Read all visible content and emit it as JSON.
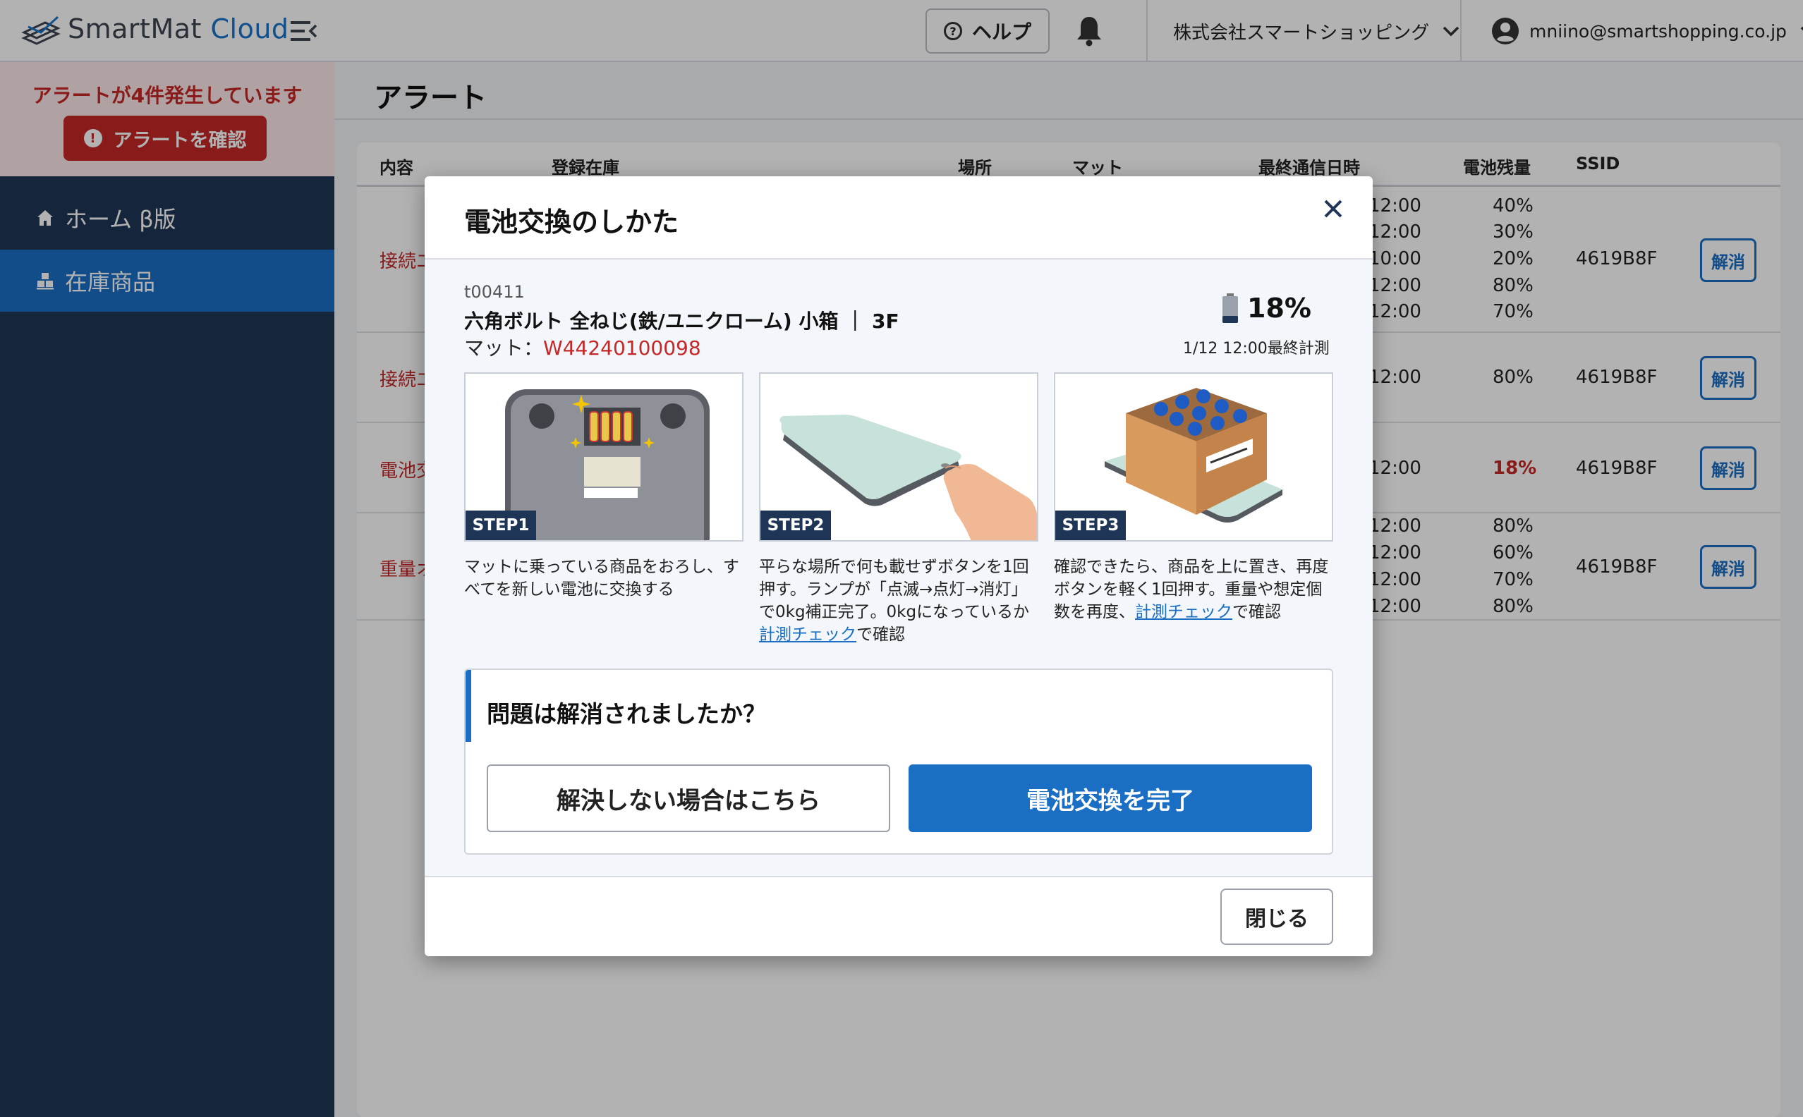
{
  "header": {
    "logo_smart": "SmartMat ",
    "logo_cloud": "Cloud",
    "help_label": "ヘルプ",
    "company": "株式会社スマートショッピング",
    "user_email": "mniino@smartshopping.co.jp"
  },
  "sidebar": {
    "alert_text": "アラートが4件発生しています",
    "alert_button": "アラートを確認",
    "items": [
      {
        "label": "ホーム β版"
      },
      {
        "label": "在庫商品"
      }
    ]
  },
  "main": {
    "page_title": "アラート",
    "columns": [
      "内容",
      "登録在庫",
      "場所",
      "マット",
      "最終通信日時",
      "電池残量",
      "SSID"
    ],
    "rows": [
      {
        "content": "接続エ",
        "times": [
          "12:00",
          "12:00",
          "10:00",
          "12:00",
          "12:00"
        ],
        "batteries": [
          "40%",
          "30%",
          "20%",
          "80%",
          "70%"
        ],
        "ssid": "4619B8F",
        "action": "解消"
      },
      {
        "content": "接続エ",
        "times": [
          "12:00"
        ],
        "batteries": [
          "80%"
        ],
        "ssid": "4619B8F",
        "action": "解消"
      },
      {
        "content": "電池交",
        "times": [
          "12:00"
        ],
        "batteries": [
          "18%"
        ],
        "ssid": "4619B8F",
        "action": "解消"
      },
      {
        "content": "重量オ",
        "times": [
          "12:00",
          "12:00",
          "12:00",
          "12:00"
        ],
        "batteries": [
          "80%",
          "60%",
          "70%",
          "80%"
        ],
        "ssid": "4619B8F",
        "action": "解消"
      }
    ]
  },
  "modal": {
    "title": "電池交換のしかた",
    "item_code": "t00411",
    "item_name": "六角ボルト 全ねじ(鉄/ユニクローム) 小箱 ｜ 3F",
    "mat_label": "マット：",
    "mat_code": "W44240100098",
    "battery_percent": "18%",
    "measured": "1/12 12:00最終計測",
    "steps": [
      {
        "label": "STEP1",
        "text": "マットに乗っている商品をおろし、すべてを新しい電池に交換する"
      },
      {
        "label": "STEP2",
        "text_before": "平らな場所で何も載せずボタンを1回押す。ランプが「点滅→点灯→消灯」で0kg補正完了。0kgになっているか",
        "link": "計測チェック",
        "text_after": "で確認"
      },
      {
        "label": "STEP3",
        "text_before": "確認できたら、商品を上に置き、再度ボタンを軽く1回押す。重量や想定個数を再度、",
        "link": "計測チェック",
        "text_after": "で確認"
      }
    ],
    "question": "問題は解消されましたか？",
    "secondary_button": "解決しない場合はこちら",
    "primary_button": "電池交換を完了",
    "close_button": "閉じる"
  },
  "colors": {
    "navy": "#1f3556",
    "primary": "#1a6fc4",
    "alert_red": "#c62828"
  }
}
